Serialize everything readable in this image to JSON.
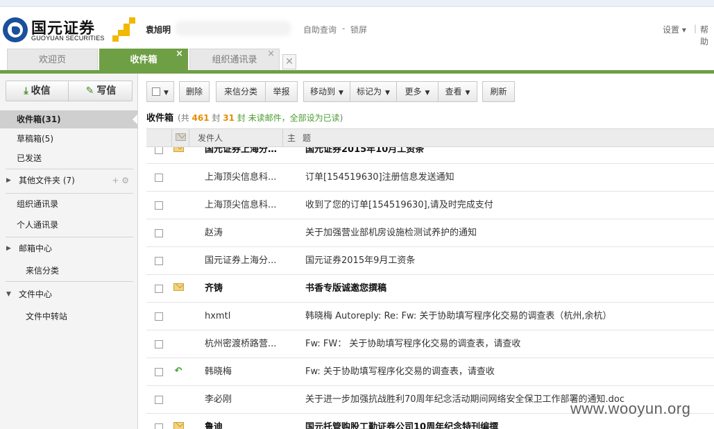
{
  "header": {
    "logo_cn": "国元证券",
    "logo_en": "GUOYUAN SECURITIES",
    "user_name": "袁旭明",
    "self_query": "自助查询",
    "separator": "-",
    "lock": "锁屏",
    "settings": "设置 ▾",
    "divider": "|",
    "help": "帮助"
  },
  "tabs": [
    {
      "label": "欢迎页"
    },
    {
      "label": "收件箱",
      "close": "×"
    },
    {
      "label": "组织通讯录",
      "close": "×"
    }
  ],
  "sidebar": {
    "receive": "收信",
    "write": "写信",
    "items": {
      "inbox": "收件箱(31)",
      "drafts": "草稿箱(5)",
      "sent": "已发送",
      "folders": "其他文件夹 (7)",
      "folders_tools": "+  ⚙",
      "org_book": "组织通讯录",
      "personal_book": "个人通讯录",
      "mail_center": "邮箱中心",
      "category": "来信分类",
      "file_center": "文件中心",
      "transfer": "文件中转站"
    }
  },
  "toolbar": {
    "delete": "删除",
    "classify": "来信分类",
    "report": "举报",
    "move_to": "移动到",
    "mark_as": "标记为",
    "more": "更多",
    "view": "查看",
    "refresh": "刷新"
  },
  "summary": {
    "title": "收件箱",
    "pre": "(共",
    "total": "461",
    "mid": "封",
    "unread_num": "31",
    "unread_text": "封 未读邮件",
    "comma": "，",
    "mark_all": "全部设为已读",
    "close": ")"
  },
  "list_header": {
    "sender": "发件人",
    "subject": "主题"
  },
  "emails": [
    {
      "sender": "国元证券上海分…",
      "subject": "国元证券2015年10月工资条",
      "icon": "envelope",
      "unread": true
    },
    {
      "sender": "上海顶尖信息科...",
      "subject": "订单[154519630]注册信息发送通知",
      "icon": "",
      "unread": false
    },
    {
      "sender": "上海顶尖信息科...",
      "subject": "收到了您的订单[154519630],请及时完成支付",
      "icon": "",
      "unread": false
    },
    {
      "sender": "赵涛",
      "subject": "关于加强营业部机房设施检测试养护的通知",
      "icon": "",
      "unread": false
    },
    {
      "sender": "国元证券上海分...",
      "subject": "国元证券2015年9月工资条",
      "icon": "",
      "unread": false
    },
    {
      "sender": "齐铸",
      "subject": "书香专版诚邀您撰稿",
      "icon": "envelope",
      "unread": true
    },
    {
      "sender": "hxmtl",
      "subject": "韩晓梅 Autoreply: Re: Fw: 关于协助填写程序化交易的调查表（杭州,余杭）",
      "icon": "",
      "unread": false
    },
    {
      "sender": "杭州密渡桥路营...",
      "subject": "Fw: FW： 关于协助填写程序化交易的调查表，请查收",
      "icon": "",
      "unread": false
    },
    {
      "sender": "韩晓梅",
      "subject": "Fw: 关于协助填写程序化交易的调查表，请查收",
      "icon": "reply",
      "unread": false
    },
    {
      "sender": "李必刚",
      "subject": "关于进一步加强抗战胜利70周年纪念活动期间网络安全保卫工作部署的通知.doc",
      "icon": "",
      "unread": false
    },
    {
      "sender": "鲁迪",
      "subject": "国元托管购股工勤证券公司10周年纪念特刊编撰",
      "icon": "envelope",
      "unread": true
    }
  ],
  "watermark": "www.wooyun.org",
  "colors": {
    "accent_green": "#6f9f45",
    "unread_orange": "#e88c00",
    "logo_blue": "#1a4f9c",
    "logo_yellow": "#f2b700"
  }
}
